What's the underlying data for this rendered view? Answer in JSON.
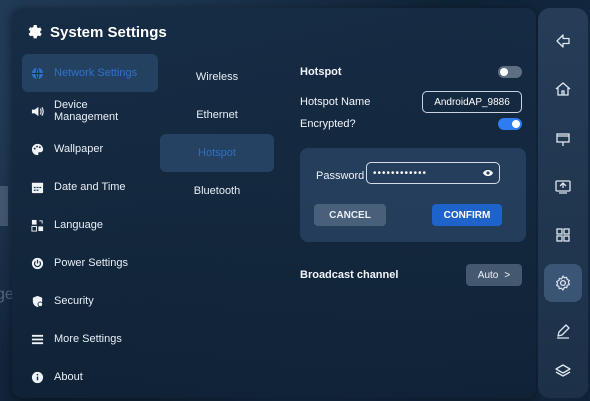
{
  "background": {
    "ghost_text": "ge"
  },
  "panel": {
    "title": "System Settings",
    "icon": "gear-icon"
  },
  "menu": {
    "items": [
      {
        "label": "Network Settings",
        "icon": "globe-icon",
        "active": true
      },
      {
        "label": "Device\nManagement",
        "icon": "speaker-icon",
        "active": false
      },
      {
        "label": "Wallpaper",
        "icon": "palette-icon",
        "active": false
      },
      {
        "label": "Date and Time",
        "icon": "calendar-icon",
        "active": false
      },
      {
        "label": "Language",
        "icon": "language-icon",
        "active": false
      },
      {
        "label": "Power Settings",
        "icon": "power-icon",
        "active": false
      },
      {
        "label": "Security",
        "icon": "shield-icon",
        "active": false
      },
      {
        "label": "More Settings",
        "icon": "list-icon",
        "active": false
      },
      {
        "label": "About",
        "icon": "info-icon",
        "active": false
      }
    ]
  },
  "subtabs": {
    "items": [
      {
        "label": "Wireless",
        "active": false
      },
      {
        "label": "Ethernet",
        "active": false
      },
      {
        "label": "Hotspot",
        "active": true
      },
      {
        "label": "Bluetooth",
        "active": false
      }
    ]
  },
  "hotspot": {
    "title": "Hotspot",
    "enabled": false,
    "name_label": "Hotspot Name",
    "name_value": "AndroidAP_9886",
    "encrypted_label": "Encrypted?",
    "encrypted": true,
    "password_label": "Password",
    "password_value": "••••••••••••",
    "eye_icon": "eye-icon",
    "cancel_label": "CANCEL",
    "confirm_label": "CONFIRM",
    "broadcast_label": "Broadcast channel",
    "broadcast_value": "Auto",
    "chevron": ">"
  },
  "sidebar": {
    "items": [
      {
        "icon": "back-icon",
        "active": false
      },
      {
        "icon": "home-icon",
        "active": false
      },
      {
        "icon": "display-icon",
        "active": false
      },
      {
        "icon": "screen-share-icon",
        "active": false
      },
      {
        "icon": "apps-grid-icon",
        "active": false
      },
      {
        "icon": "settings-icon",
        "active": true
      },
      {
        "icon": "pen-icon",
        "active": false
      },
      {
        "icon": "layers-icon",
        "active": false
      }
    ]
  },
  "colors": {
    "accent": "#2e7cf2",
    "active_text": "#2f72c9",
    "confirm_button": "#1d63c9"
  }
}
